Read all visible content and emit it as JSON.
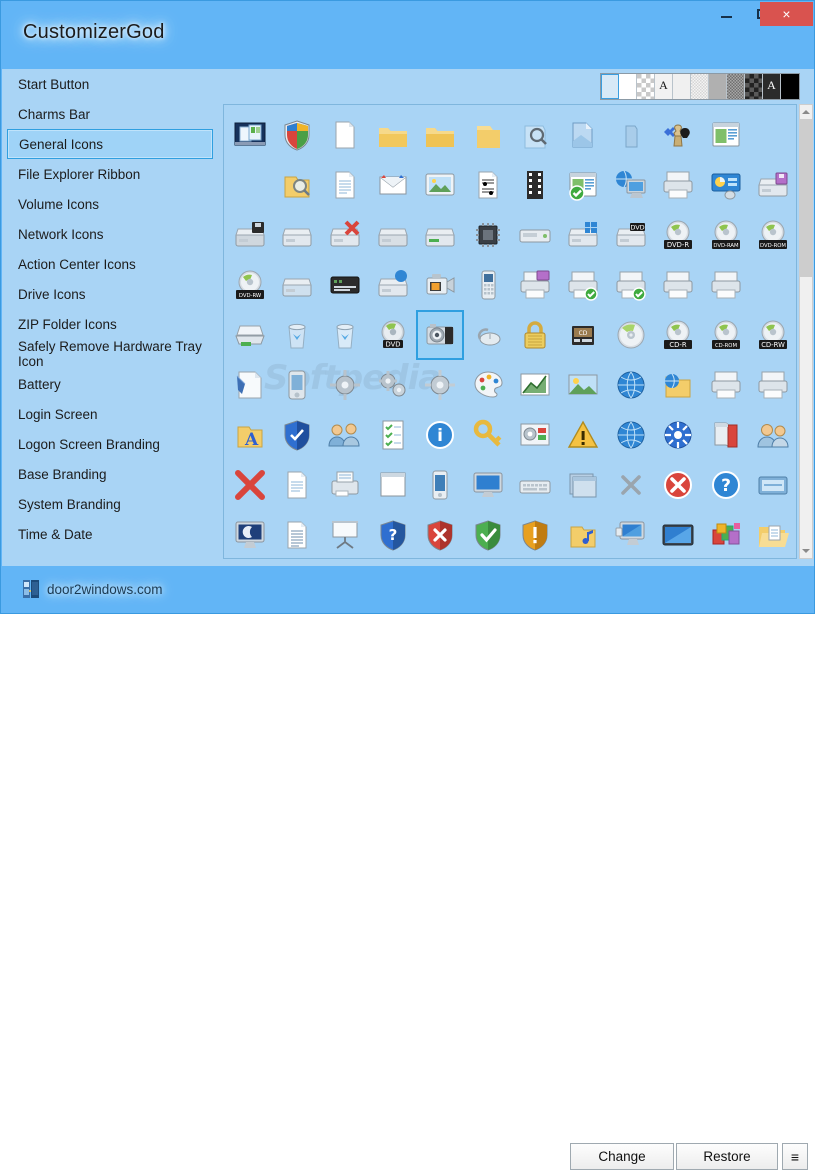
{
  "window": {
    "title": "CustomizerGod",
    "controls": {
      "minimize_label": "Minimize",
      "maximize_label": "Maximize",
      "close_label": "×",
      "close_color": "#d9534f"
    }
  },
  "theme": {
    "window_bg": "#62b5f6",
    "panel_bg": "#a9d4f5",
    "accent": "#2f9fe0",
    "text": "#1c1c1c"
  },
  "sidebar": {
    "selected_index": 2,
    "items": [
      {
        "label": "Start Button"
      },
      {
        "label": "Charms Bar"
      },
      {
        "label": "General Icons"
      },
      {
        "label": "File Explorer Ribbon"
      },
      {
        "label": "Volume Icons"
      },
      {
        "label": "Network Icons"
      },
      {
        "label": "Action Center Icons"
      },
      {
        "label": "Drive Icons"
      },
      {
        "label": "ZIP Folder Icons"
      },
      {
        "label": "Safely Remove Hardware Tray Icon"
      },
      {
        "label": "Battery"
      },
      {
        "label": "Login Screen"
      },
      {
        "label": "Logon Screen Branding"
      },
      {
        "label": "Base Branding"
      },
      {
        "label": "System Branding"
      },
      {
        "label": "Time & Date"
      }
    ]
  },
  "palette": {
    "selected_index": 0,
    "swatches": [
      {
        "name": "background-light-blue",
        "color": "#d7e9f7",
        "pattern": "none",
        "letter": ""
      },
      {
        "name": "white",
        "color": "#ffffff",
        "pattern": "none",
        "letter": ""
      },
      {
        "name": "checker-light",
        "color": "#ffffff",
        "pattern": "checker-light",
        "letter": ""
      },
      {
        "name": "letter-a-light",
        "color": "#f2f2f2",
        "pattern": "none",
        "letter": "A"
      },
      {
        "name": "near-white",
        "color": "#f0f0f0",
        "pattern": "none",
        "letter": ""
      },
      {
        "name": "dither-light",
        "color": "#e4e4e4",
        "pattern": "dither-light",
        "letter": ""
      },
      {
        "name": "gray",
        "color": "#b0b0b0",
        "pattern": "none",
        "letter": ""
      },
      {
        "name": "dither-dark",
        "color": "#8d8d8d",
        "pattern": "dither-dark",
        "letter": ""
      },
      {
        "name": "checker-dark",
        "color": "#3a3a3a",
        "pattern": "checker-dark",
        "letter": ""
      },
      {
        "name": "letter-a-dark",
        "color": "#2b2b2b",
        "pattern": "none",
        "letter": "A"
      },
      {
        "name": "black",
        "color": "#000000",
        "pattern": "none",
        "letter": ""
      }
    ]
  },
  "icon_grid": {
    "columns": 12,
    "selected_index": 52,
    "watermark": "Softpedia",
    "icons": [
      {
        "name": "desktop-windows-icon",
        "labels": ""
      },
      {
        "name": "security-shield-icon",
        "labels": ""
      },
      {
        "name": "blank-document-icon",
        "labels": ""
      },
      {
        "name": "folder-closed-icon",
        "labels": ""
      },
      {
        "name": "folder-open-icon",
        "labels": ""
      },
      {
        "name": "folder-plain-icon",
        "labels": ""
      },
      {
        "name": "search-results-icon",
        "labels": ""
      },
      {
        "name": "document-blue-icon",
        "labels": ""
      },
      {
        "name": "folder-blue-thin-icon",
        "labels": ""
      },
      {
        "name": "games-chess-icon",
        "labels": ""
      },
      {
        "name": "program-window-icon",
        "labels": ""
      },
      {
        "name": "empty-slot",
        "labels": ""
      },
      {
        "name": "empty-slot",
        "labels": ""
      },
      {
        "name": "folder-search-icon",
        "labels": ""
      },
      {
        "name": "text-document-icon",
        "labels": ""
      },
      {
        "name": "mail-envelope-icon",
        "labels": ""
      },
      {
        "name": "picture-frame-icon",
        "labels": ""
      },
      {
        "name": "music-score-icon",
        "labels": ""
      },
      {
        "name": "film-strip-icon",
        "labels": ""
      },
      {
        "name": "program-check-icon",
        "labels": ""
      },
      {
        "name": "network-computer-icon",
        "labels": ""
      },
      {
        "name": "printer-folder-icon",
        "labels": ""
      },
      {
        "name": "control-panel-icon",
        "labels": ""
      },
      {
        "name": "floppy-drive-icon",
        "labels": ""
      },
      {
        "name": "floppy-drive-black-icon",
        "labels": ""
      },
      {
        "name": "hard-drive-icon",
        "labels": ""
      },
      {
        "name": "drive-error-icon",
        "labels": ""
      },
      {
        "name": "drive-gray-icon",
        "labels": ""
      },
      {
        "name": "drive-green-icon",
        "labels": ""
      },
      {
        "name": "cpu-chip-icon",
        "labels": ""
      },
      {
        "name": "drive-wide-icon",
        "labels": ""
      },
      {
        "name": "drive-windows-icon",
        "labels": ""
      },
      {
        "name": "dvd-drive-icon",
        "labels": "DVD"
      },
      {
        "name": "dvd-r-disc-icon",
        "labels": "DVD-R"
      },
      {
        "name": "dvd-ram-disc-icon",
        "labels": "DVD-RAM"
      },
      {
        "name": "dvd-rom-disc-icon",
        "labels": "DVD-ROM"
      },
      {
        "name": "dvd-rw-disc-icon",
        "labels": "DVD-RW"
      },
      {
        "name": "hard-drive-blue-icon",
        "labels": ""
      },
      {
        "name": "server-rack-icon",
        "labels": ""
      },
      {
        "name": "network-drive-icon",
        "labels": ""
      },
      {
        "name": "camcorder-icon",
        "labels": ""
      },
      {
        "name": "mobile-phone-icon",
        "labels": ""
      },
      {
        "name": "printer-purple-icon",
        "labels": ""
      },
      {
        "name": "printer-check-icon",
        "labels": ""
      },
      {
        "name": "printer-check2-icon",
        "labels": ""
      },
      {
        "name": "printer-gray-icon",
        "labels": ""
      },
      {
        "name": "printer-white-icon",
        "labels": ""
      },
      {
        "name": "empty-slot",
        "labels": ""
      },
      {
        "name": "scanner-icon",
        "labels": ""
      },
      {
        "name": "recycle-bin-full-icon",
        "labels": ""
      },
      {
        "name": "recycle-bin-empty-icon",
        "labels": ""
      },
      {
        "name": "dvd-disc-icon",
        "labels": "DVD"
      },
      {
        "name": "digital-camera-icon",
        "labels": ""
      },
      {
        "name": "optical-mouse-icon",
        "labels": ""
      },
      {
        "name": "padlock-icon",
        "labels": ""
      },
      {
        "name": "audio-cd-icon",
        "labels": ""
      },
      {
        "name": "cd-disc-icon",
        "labels": ""
      },
      {
        "name": "cd-r-disc-icon",
        "labels": "CD-R"
      },
      {
        "name": "cd-rom-disc-icon",
        "labels": "CD-ROM"
      },
      {
        "name": "cd-rw-disc-icon",
        "labels": "CD-RW"
      },
      {
        "name": "notepad-pen-icon",
        "labels": ""
      },
      {
        "name": "pda-device-icon",
        "labels": ""
      },
      {
        "name": "settings-gear-icon",
        "labels": ""
      },
      {
        "name": "settings-gears-icon",
        "labels": ""
      },
      {
        "name": "settings-gear-single-icon",
        "labels": ""
      },
      {
        "name": "paint-palette-icon",
        "labels": ""
      },
      {
        "name": "chart-graph-icon",
        "labels": ""
      },
      {
        "name": "photo-landscape-icon",
        "labels": ""
      },
      {
        "name": "internet-globe-icon",
        "labels": ""
      },
      {
        "name": "folder-globe-icon",
        "labels": ""
      },
      {
        "name": "printer-plain-icon",
        "labels": ""
      },
      {
        "name": "printer-plain2-icon",
        "labels": ""
      },
      {
        "name": "font-folder-icon",
        "labels": "A"
      },
      {
        "name": "shield-blue-icon",
        "labels": ""
      },
      {
        "name": "users-group-icon",
        "labels": ""
      },
      {
        "name": "task-list-icon",
        "labels": ""
      },
      {
        "name": "info-circle-icon",
        "labels": ""
      },
      {
        "name": "key-icon",
        "labels": ""
      },
      {
        "name": "settings-color-icon",
        "labels": ""
      },
      {
        "name": "warning-triangle-icon",
        "labels": ""
      },
      {
        "name": "globe-network-icon",
        "labels": ""
      },
      {
        "name": "network-hub-icon",
        "labels": ""
      },
      {
        "name": "book-help-icon",
        "labels": ""
      },
      {
        "name": "users-pair-icon",
        "labels": ""
      },
      {
        "name": "red-x-icon",
        "labels": ""
      },
      {
        "name": "document-page-icon",
        "labels": ""
      },
      {
        "name": "fax-machine-icon",
        "labels": ""
      },
      {
        "name": "window-blank-icon",
        "labels": ""
      },
      {
        "name": "mobile-device-icon",
        "labels": ""
      },
      {
        "name": "monitor-blue-icon",
        "labels": ""
      },
      {
        "name": "keyboard-icon",
        "labels": ""
      },
      {
        "name": "window-stack-icon",
        "labels": ""
      },
      {
        "name": "gray-x-icon",
        "labels": ""
      },
      {
        "name": "error-circle-icon",
        "labels": ""
      },
      {
        "name": "help-question-icon",
        "labels": ""
      },
      {
        "name": "card-window-icon",
        "labels": ""
      },
      {
        "name": "monitor-moon-icon",
        "labels": ""
      },
      {
        "name": "notepad-lines-icon",
        "labels": ""
      },
      {
        "name": "presentation-screen-icon",
        "labels": ""
      },
      {
        "name": "help-shield-icon",
        "labels": ""
      },
      {
        "name": "error-shield-icon",
        "labels": ""
      },
      {
        "name": "ok-shield-icon",
        "labels": ""
      },
      {
        "name": "warning-shield-icon",
        "labels": ""
      },
      {
        "name": "music-folder-icon",
        "labels": ""
      },
      {
        "name": "display-settings-icon",
        "labels": ""
      },
      {
        "name": "monitor-screen-icon",
        "labels": ""
      },
      {
        "name": "colorful-blocks-icon",
        "labels": ""
      },
      {
        "name": "open-folder-doc-icon",
        "labels": ""
      }
    ]
  },
  "scrollbar": {
    "up_arrow": "▲",
    "down_arrow": "▼",
    "thumb_position_percent": 0,
    "thumb_size_percent": 35
  },
  "footer": {
    "brand": "door2windows.com",
    "change_label": "Change",
    "restore_label": "Restore",
    "menu_label": "≡"
  }
}
